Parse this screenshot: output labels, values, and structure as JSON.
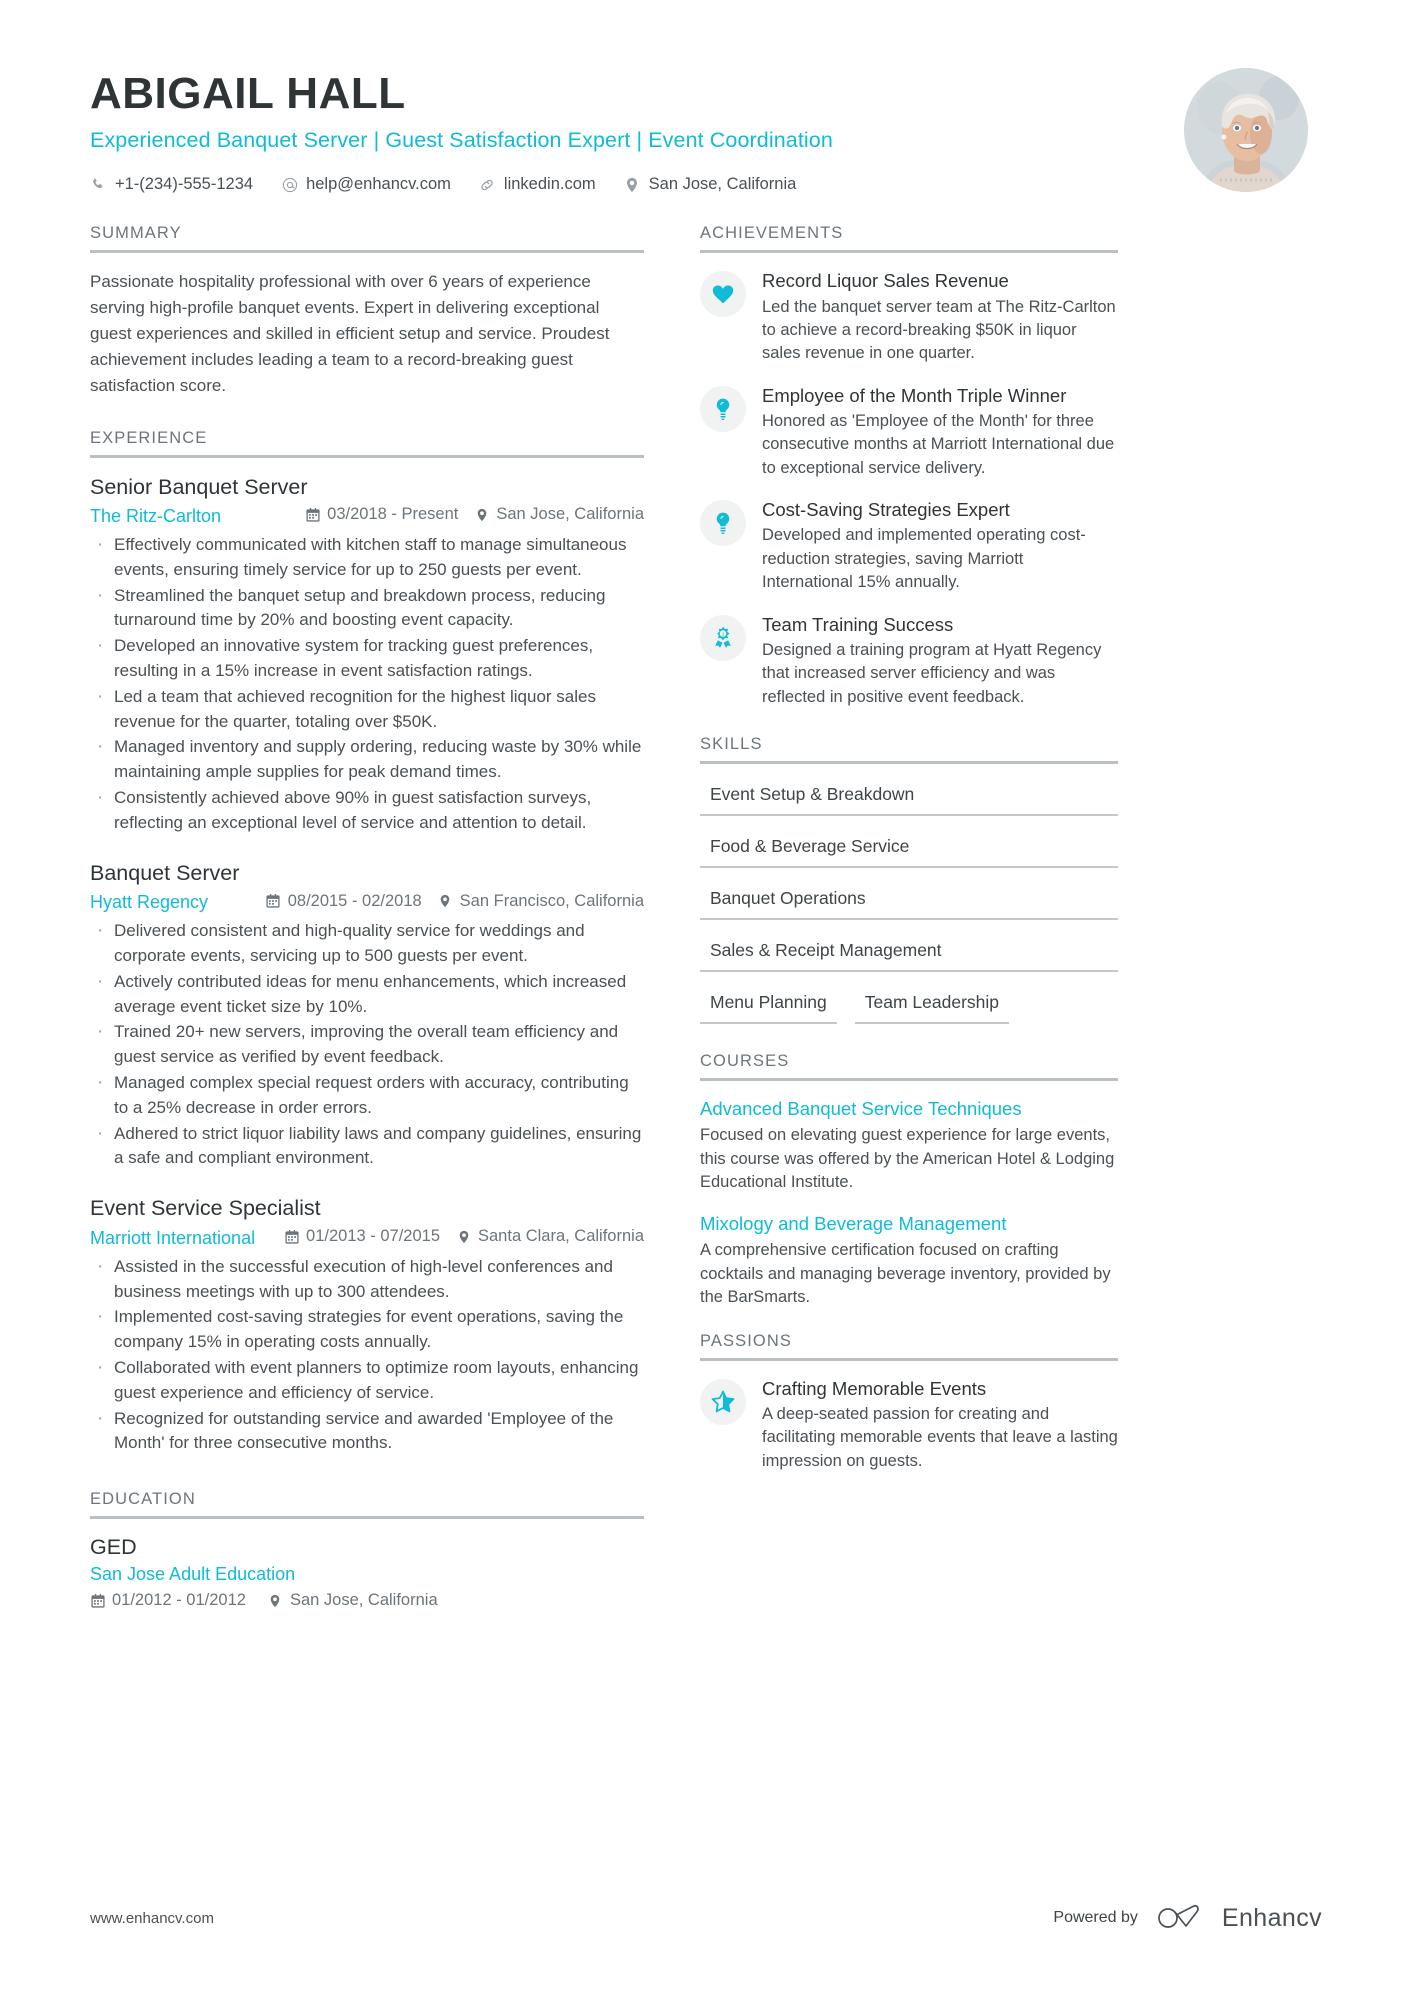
{
  "header": {
    "name": "ABIGAIL HALL",
    "headline": "Experienced Banquet Server | Guest Satisfaction Expert | Event Coordination",
    "contacts": [
      {
        "icon": "phone-icon",
        "text": "+1-(234)-555-1234"
      },
      {
        "icon": "email-icon",
        "text": "help@enhancv.com"
      },
      {
        "icon": "link-icon",
        "text": "linkedin.com"
      },
      {
        "icon": "location-icon",
        "text": "San Jose, California"
      }
    ]
  },
  "summary": {
    "title": "SUMMARY",
    "text": "Passionate hospitality professional with over 6 years of experience serving high-profile banquet events. Expert in delivering exceptional guest experiences and skilled in efficient setup and service. Proudest achievement includes leading a team to a record-breaking guest satisfaction score."
  },
  "experience": {
    "title": "EXPERIENCE",
    "jobs": [
      {
        "title": "Senior Banquet Server",
        "company": "The Ritz-Carlton",
        "dates": "03/2018 - Present",
        "location": "San Jose, California",
        "bullets": [
          "Effectively communicated with kitchen staff to manage simultaneous events, ensuring timely service for up to 250 guests per event.",
          "Streamlined the banquet setup and breakdown process, reducing turnaround time by 20% and boosting event capacity.",
          "Developed an innovative system for tracking guest preferences, resulting in a 15% increase in event satisfaction ratings.",
          "Led a team that achieved recognition for the highest liquor sales revenue for the quarter, totaling over $50K.",
          "Managed inventory and supply ordering, reducing waste by 30% while maintaining ample supplies for peak demand times.",
          "Consistently achieved above 90% in guest satisfaction surveys, reflecting an exceptional level of service and attention to detail."
        ]
      },
      {
        "title": "Banquet Server",
        "company": "Hyatt Regency",
        "dates": "08/2015 - 02/2018",
        "location": "San Francisco, California",
        "bullets": [
          "Delivered consistent and high-quality service for weddings and corporate events, servicing up to 500 guests per event.",
          "Actively contributed ideas for menu enhancements, which increased average event ticket size by 10%.",
          "Trained 20+ new servers, improving the overall team efficiency and guest service as verified by event feedback.",
          "Managed complex special request orders with accuracy, contributing to a 25% decrease in order errors.",
          "Adhered to strict liquor liability laws and company guidelines, ensuring a safe and compliant environment."
        ]
      },
      {
        "title": "Event Service Specialist",
        "company": "Marriott International",
        "dates": "01/2013 - 07/2015",
        "location": "Santa Clara, California",
        "bullets": [
          "Assisted in the successful execution of high-level conferences and business meetings with up to 300 attendees.",
          "Implemented cost-saving strategies for event operations, saving the company 15% in operating costs annually.",
          "Collaborated with event planners to optimize room layouts, enhancing guest experience and efficiency of service.",
          "Recognized for outstanding service and awarded 'Employee of the Month' for three consecutive months."
        ]
      }
    ]
  },
  "education": {
    "title": "EDUCATION",
    "entries": [
      {
        "degree": "GED",
        "school": "San Jose Adult Education",
        "dates": "01/2012 - 01/2012",
        "location": "San Jose, California"
      }
    ]
  },
  "achievements": {
    "title": "ACHIEVEMENTS",
    "items": [
      {
        "icon": "heart-icon",
        "title": "Record Liquor Sales Revenue",
        "desc": "Led the banquet server team at The Ritz-Carlton to achieve a record-breaking $50K in liquor sales revenue in one quarter."
      },
      {
        "icon": "lightbulb-icon",
        "title": "Employee of the Month Triple Winner",
        "desc": "Honored as 'Employee of the Month' for three consecutive months at Marriott International due to exceptional service delivery."
      },
      {
        "icon": "lightbulb-icon",
        "title": "Cost-Saving Strategies Expert",
        "desc": "Developed and implemented operating cost-reduction strategies, saving Marriott International 15% annually."
      },
      {
        "icon": "award-ribbon-icon",
        "title": "Team Training Success",
        "desc": "Designed a training program at Hyatt Regency that increased server efficiency and was reflected in positive event feedback."
      }
    ]
  },
  "skills": {
    "title": "SKILLS",
    "items": [
      "Event Setup & Breakdown",
      "Food & Beverage Service",
      "Banquet Operations",
      "Sales & Receipt Management",
      "Menu Planning",
      "Team Leadership"
    ]
  },
  "courses": {
    "title": "COURSES",
    "items": [
      {
        "title": "Advanced Banquet Service Techniques",
        "desc": "Focused on elevating guest experience for large events, this course was offered by the American Hotel & Lodging Educational Institute."
      },
      {
        "title": "Mixology and Beverage Management",
        "desc": "A comprehensive certification focused on crafting cocktails and managing beverage inventory, provided by the BarSmarts."
      }
    ]
  },
  "passions": {
    "title": "PASSIONS",
    "items": [
      {
        "icon": "star-half-icon",
        "title": "Crafting Memorable Events",
        "desc": "A deep-seated passion for creating and facilitating memorable events that leave a lasting impression on guests."
      }
    ]
  },
  "footer": {
    "url": "www.enhancv.com",
    "powered_by": "Powered by",
    "brand": "Enhancv"
  },
  "colors": {
    "accent": "#0fbbd6",
    "text": "#3e4447",
    "muted": "#6d757a",
    "rule": "#b9bfc3"
  }
}
